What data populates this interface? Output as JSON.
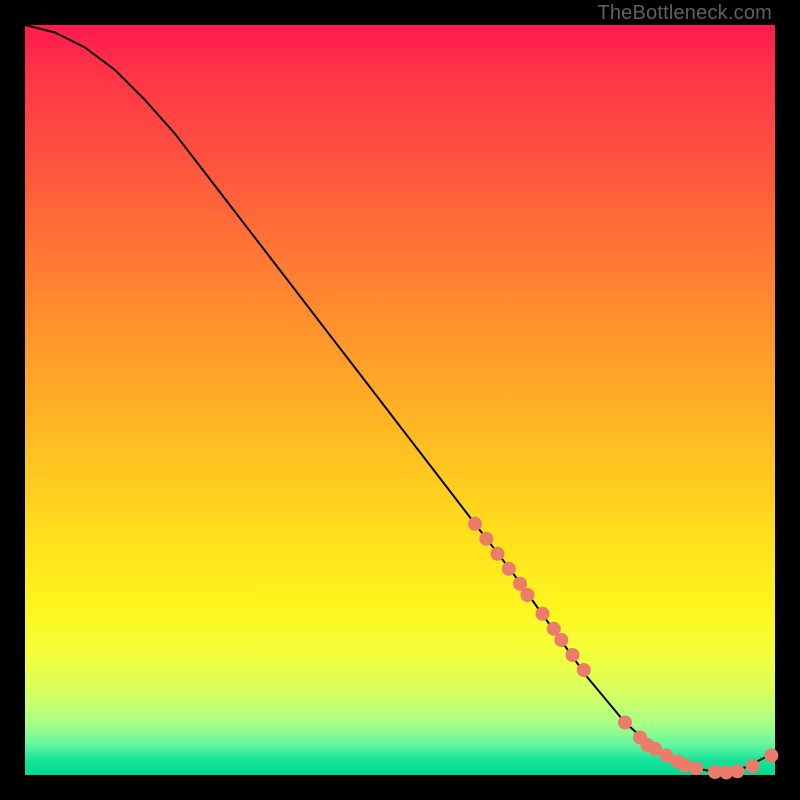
{
  "watermark": "TheBottleneck.com",
  "chart_data": {
    "type": "line",
    "title": "",
    "xlabel": "",
    "ylabel": "",
    "xlim": [
      0,
      100
    ],
    "ylim": [
      0,
      100
    ],
    "series": [
      {
        "name": "bottleneck-curve",
        "x": [
          0,
          4,
          8,
          12,
          16,
          20,
          25,
          30,
          35,
          40,
          45,
          50,
          55,
          60,
          65,
          70,
          75,
          80,
          84,
          88,
          92,
          96,
          100
        ],
        "y": [
          100,
          99,
          97,
          94,
          90,
          85.5,
          79,
          72.5,
          66,
          59.5,
          53,
          46.5,
          40,
          33.5,
          27,
          20,
          13,
          7,
          3.5,
          1.2,
          0.4,
          1.0,
          3.0
        ]
      }
    ],
    "markers": {
      "name": "highlight-points",
      "x": [
        60,
        61.5,
        63,
        64.5,
        66,
        67,
        69,
        70.5,
        71.5,
        73,
        74.5,
        80,
        82,
        83,
        84,
        85.5,
        87,
        88,
        89.5,
        92,
        93.5,
        95,
        97,
        99.5
      ],
      "y": [
        33.5,
        31.5,
        29.5,
        27.5,
        25.5,
        24,
        21.5,
        19.5,
        18,
        16,
        14,
        7,
        5,
        4,
        3.5,
        2.6,
        1.8,
        1.3,
        0.9,
        0.4,
        0.35,
        0.5,
        1.2,
        2.6
      ]
    },
    "background_gradient": {
      "top": "#ff1a4d",
      "mid": "#ffe41c",
      "bottom": "#00d890"
    }
  }
}
